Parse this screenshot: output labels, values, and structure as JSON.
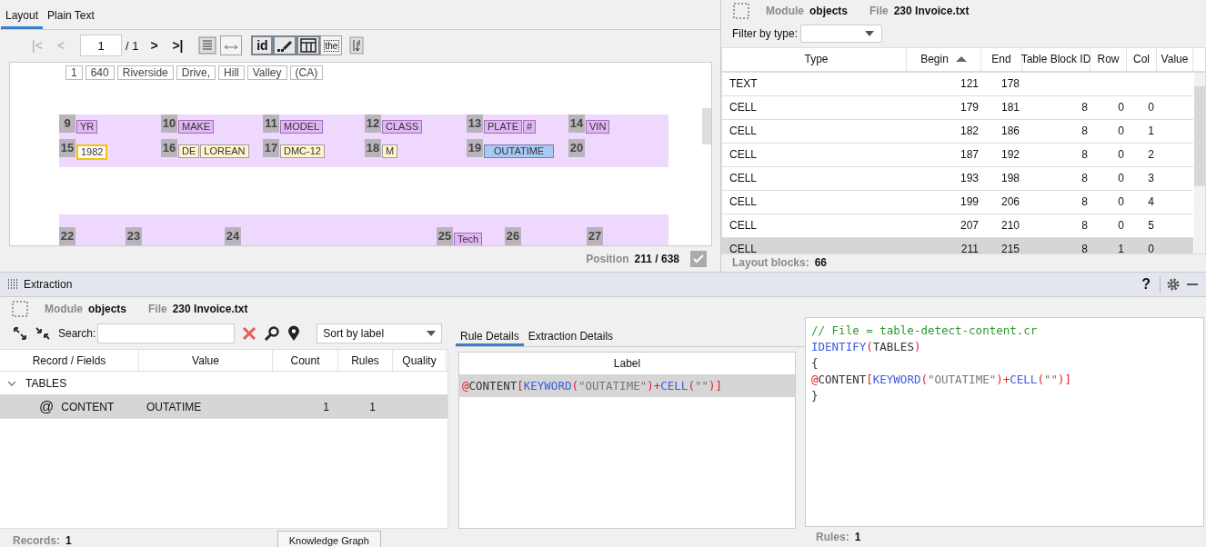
{
  "layout_tabs": [
    {
      "label": "Layout",
      "selected": true
    },
    {
      "label": "Plain Text",
      "selected": false
    }
  ],
  "pager": {
    "back": [
      {
        "label": "|<",
        "disabled": true
      },
      {
        "label": "<",
        "disabled": true
      }
    ],
    "page": "1",
    "total": "/ 1",
    "forward": [
      {
        "label": ">",
        "disabled": false
      },
      {
        "label": ">|",
        "disabled": false
      }
    ]
  },
  "view_toggles": [
    {
      "kind": "text",
      "label": "id",
      "pressed": true
    },
    {
      "kind": "brush",
      "pressed": true
    },
    {
      "kind": "table",
      "pressed": true
    },
    {
      "kind": "dotted-text",
      "label": "the",
      "pressed": false
    }
  ],
  "document": {
    "address_words": [
      "1",
      "640",
      "Riverside",
      "Drive,",
      "Hill",
      "Valley",
      "(CA)"
    ],
    "bands": [
      {
        "cells": [
          {
            "number": "9",
            "words": [
              {
                "text": "YR",
                "kind": "header"
              }
            ]
          },
          {
            "number": "10",
            "words": [
              {
                "text": "MAKE",
                "kind": "header"
              }
            ]
          },
          {
            "number": "11",
            "words": [
              {
                "text": "MODEL",
                "kind": "header"
              }
            ]
          },
          {
            "number": "12",
            "words": [
              {
                "text": "CLASS",
                "kind": "header"
              }
            ]
          },
          {
            "number": "13",
            "words": [
              {
                "text": "PLATE",
                "kind": "header"
              },
              {
                "text": "#",
                "kind": "header"
              }
            ]
          },
          {
            "number": "14",
            "words": [
              {
                "text": "VIN",
                "kind": "header"
              }
            ]
          },
          {
            "number": "15",
            "words": [
              {
                "text": "1982",
                "kind": "cursor"
              }
            ]
          },
          {
            "number": "16",
            "words": [
              {
                "text": "DE",
                "kind": "value"
              },
              {
                "text": "LOREAN",
                "kind": "value"
              }
            ]
          },
          {
            "number": "17",
            "words": [
              {
                "text": "DMC-12",
                "kind": "value"
              }
            ]
          },
          {
            "number": "18",
            "words": [
              {
                "text": "M",
                "kind": "value"
              }
            ]
          },
          {
            "number": "19",
            "words": [
              {
                "text": "OUTATIME",
                "kind": "match"
              }
            ]
          },
          {
            "number": "20"
          }
        ]
      },
      {
        "cells": [
          {
            "number": "22"
          },
          {
            "number": "23"
          },
          {
            "number": "24"
          },
          {
            "number": "25",
            "words": [
              {
                "text": "Tech",
                "kind": "header"
              }
            ]
          },
          {
            "number": "26"
          },
          {
            "number": "27"
          }
        ]
      }
    ]
  },
  "position": {
    "label": "Position",
    "value": "211 / 638",
    "checked": true
  },
  "objects": {
    "module_label": "Module",
    "module": "objects",
    "file_label": "File",
    "file": "230 Invoice.txt",
    "filter_label": "Filter by type:",
    "columns": [
      {
        "label": "Type",
        "sorted": false
      },
      {
        "label": "Begin",
        "sorted": true
      },
      {
        "label": "End",
        "sorted": false
      },
      {
        "label": "Table Block ID",
        "sorted": false
      },
      {
        "label": "Row",
        "sorted": false
      },
      {
        "label": "Col",
        "sorted": false
      },
      {
        "label": "Value",
        "sorted": false
      }
    ],
    "rows": [
      {
        "type": "TEXT",
        "begin": "121",
        "end": "178",
        "selected": false
      },
      {
        "type": "CELL",
        "begin": "179",
        "end": "181",
        "block": "8",
        "row": "0",
        "col": "0",
        "selected": false
      },
      {
        "type": "CELL",
        "begin": "182",
        "end": "186",
        "block": "8",
        "row": "0",
        "col": "1",
        "selected": false
      },
      {
        "type": "CELL",
        "begin": "187",
        "end": "192",
        "block": "8",
        "row": "0",
        "col": "2",
        "selected": false
      },
      {
        "type": "CELL",
        "begin": "193",
        "end": "198",
        "block": "8",
        "row": "0",
        "col": "3",
        "selected": false
      },
      {
        "type": "CELL",
        "begin": "199",
        "end": "206",
        "block": "8",
        "row": "0",
        "col": "4",
        "selected": false
      },
      {
        "type": "CELL",
        "begin": "207",
        "end": "210",
        "block": "8",
        "row": "0",
        "col": "5",
        "selected": false
      },
      {
        "type": "CELL",
        "begin": "211",
        "end": "215",
        "block": "8",
        "row": "1",
        "col": "0",
        "selected": true
      }
    ],
    "footer_label": "Layout blocks:",
    "footer_value": "66"
  },
  "extraction": {
    "title": "Extraction",
    "help": "?",
    "module_label": "Module",
    "module": "objects",
    "file_label": "File",
    "file": "230 Invoice.txt",
    "search_label": "Search:",
    "sort": "Sort by label",
    "columns": [
      "Record / Fields",
      "Value",
      "Count",
      "Rules",
      "Quality"
    ],
    "tree": [
      {
        "label": "TABLES",
        "expanded": true,
        "selected": false,
        "children": [
          {
            "marker": "@",
            "label": "CONTENT",
            "value": "OUTATIME",
            "count": "1",
            "rules": "1",
            "selected": true
          }
        ]
      }
    ],
    "records_label": "Records:",
    "records": "1",
    "graph_tab": "Knowledge Graph"
  },
  "rule_tabs": [
    {
      "label": "Rule Details",
      "selected": true
    },
    {
      "label": "Extraction Details",
      "selected": false
    }
  ],
  "rule_table": {
    "column": "Label",
    "rows": [
      {
        "selected": true,
        "tokens": [
          {
            "kind": "punct",
            "text": "@"
          },
          {
            "kind": "plain",
            "text": "CONTENT"
          },
          {
            "kind": "punct",
            "text": "["
          },
          {
            "kind": "func",
            "text": "KEYWORD"
          },
          {
            "kind": "punct",
            "text": "("
          },
          {
            "kind": "string",
            "text": "\"OUTATIME\""
          },
          {
            "kind": "punct",
            "text": ")+"
          },
          {
            "kind": "func",
            "text": "CELL"
          },
          {
            "kind": "punct",
            "text": "("
          },
          {
            "kind": "string",
            "text": "\"\""
          },
          {
            "kind": "punct",
            "text": ")]"
          }
        ]
      }
    ]
  },
  "editor": {
    "lines": [
      [
        {
          "kind": "comment",
          "text": "// File = table-detect-content.cr"
        }
      ],
      [
        {
          "kind": "func",
          "text": "IDENTIFY"
        },
        {
          "kind": "punct",
          "text": "("
        },
        {
          "kind": "plain",
          "text": "TABLES"
        },
        {
          "kind": "punct",
          "text": ")"
        }
      ],
      [
        {
          "kind": "plain",
          "text": "{"
        }
      ],
      [
        {
          "kind": "punct",
          "text": "@"
        },
        {
          "kind": "plain",
          "text": "CONTENT"
        },
        {
          "kind": "punct",
          "text": "["
        },
        {
          "kind": "func",
          "text": "KEYWORD"
        },
        {
          "kind": "punct",
          "text": "("
        },
        {
          "kind": "string",
          "text": "\"OUTATIME\""
        },
        {
          "kind": "punct",
          "text": ")+"
        },
        {
          "kind": "func",
          "text": "CELL"
        },
        {
          "kind": "punct",
          "text": "("
        },
        {
          "kind": "string",
          "text": "\"\""
        },
        {
          "kind": "punct",
          "text": ")]"
        }
      ],
      [
        {
          "kind": "plain",
          "text": "}"
        }
      ]
    ],
    "footer_label": "Rules:",
    "footer_value": "1"
  }
}
